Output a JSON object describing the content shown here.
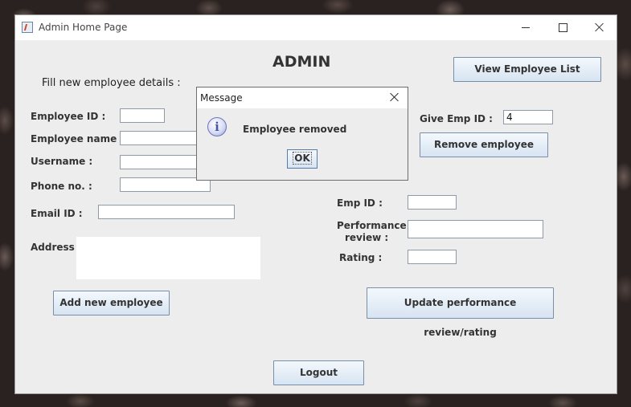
{
  "window": {
    "title": "Admin Home Page",
    "icon": "java-app-icon"
  },
  "header": {
    "title": "ADMIN",
    "subtitle": "Fill new employee details :"
  },
  "new_employee": {
    "employee_id_label": "Employee ID :",
    "employee_id_value": "",
    "employee_name_label": "Employee name :",
    "employee_name_value": "",
    "username_label": "Username :",
    "username_value": "",
    "phone_label": "Phone no. :",
    "phone_value": "",
    "email_label": "Email ID :",
    "email_value": "",
    "address_label": "Address :",
    "address_value": "",
    "add_button": "Add new employee"
  },
  "view_list_button": "View Employee List",
  "remove": {
    "give_id_label": "Give Emp ID :",
    "give_id_value": "4",
    "remove_button": "Remove employee"
  },
  "performance": {
    "emp_id_label": "Emp ID :",
    "emp_id_value": "",
    "review_label_line1": "Performance",
    "review_label_line2": "review :",
    "review_value": "",
    "rating_label": "Rating :",
    "rating_value": "",
    "update_button": "Update performance review/rating"
  },
  "logout_button": "Logout",
  "dialog": {
    "title": "Message",
    "message": "Employee removed",
    "ok_button": "OK",
    "icon": "info-icon"
  },
  "colors": {
    "button_border": "#7a8ea8",
    "panel_bg": "#ededed"
  }
}
